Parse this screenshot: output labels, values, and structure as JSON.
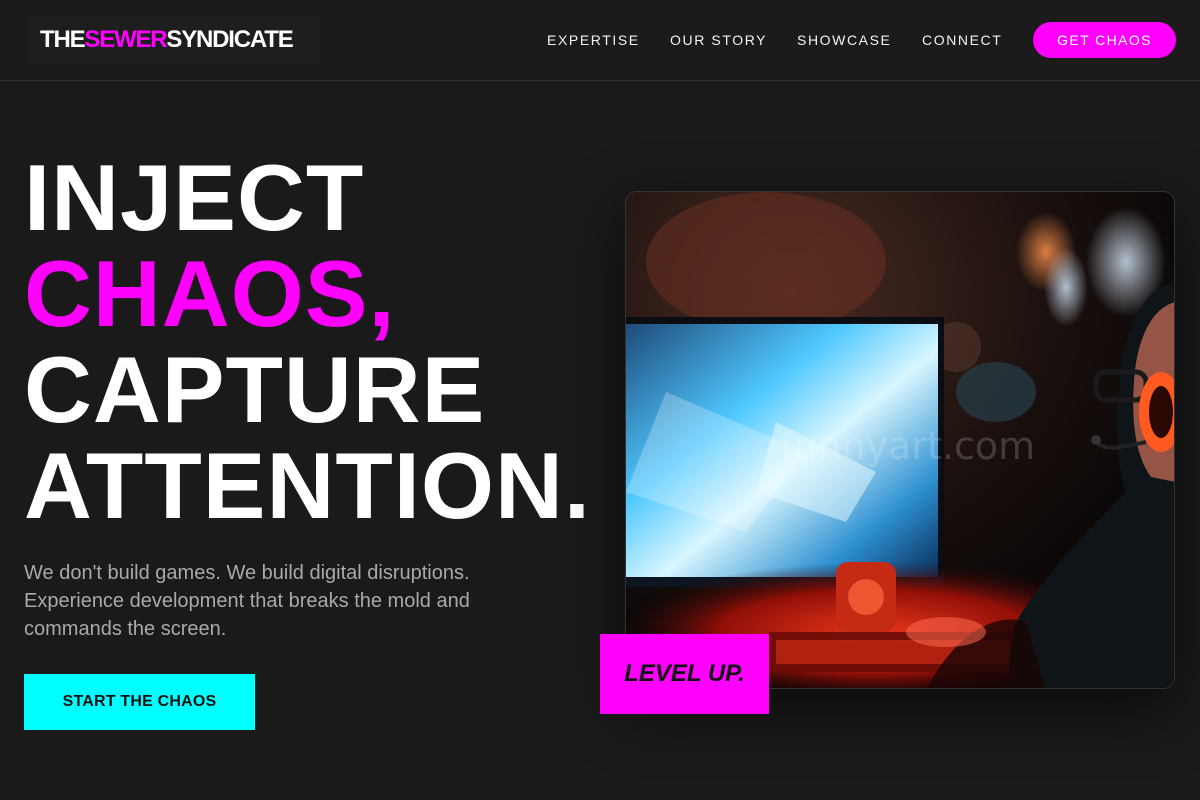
{
  "brand": {
    "part1": "THE ",
    "part2": "SEWER",
    "part3": " SYNDICATE"
  },
  "nav": {
    "items": [
      {
        "label": "EXPERTISE"
      },
      {
        "label": "OUR STORY"
      },
      {
        "label": "SHOWCASE"
      },
      {
        "label": "CONNECT"
      }
    ],
    "cta_label": "GET CHAOS"
  },
  "hero": {
    "headline_line1": "INJECT",
    "headline_line2": "CHAOS,",
    "headline_line3": "CAPTURE",
    "headline_line4": "ATTENTION.",
    "subtext": "We don't build games. We build digital disruptions. Experience development that breaks the mold and commands the screen.",
    "button_label": "START THE CHAOS",
    "badge_label": "LEVEL UP.",
    "watermark": "funnyart.com"
  },
  "colors": {
    "background": "#1a1a1a",
    "accent_pink": "#ff00ff",
    "accent_cyan": "#00ffff",
    "subtext": "#a9a9a9"
  },
  "icons": {
    "hero_image": "gamer-at-monitor-photo"
  }
}
